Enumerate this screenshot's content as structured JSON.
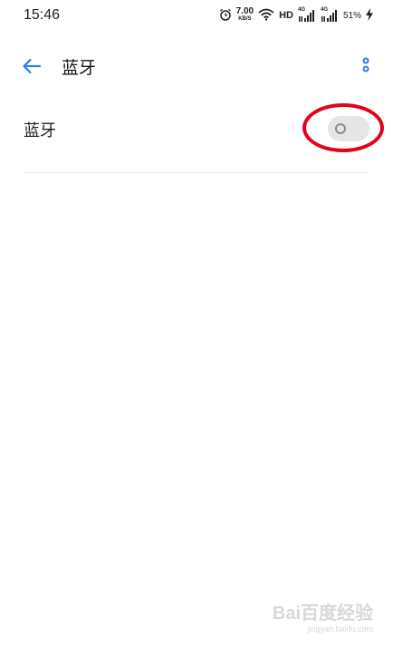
{
  "status_bar": {
    "time": "15:46",
    "net_speed_value": "7.00",
    "net_speed_unit": "KB/S",
    "hd_label": "HD",
    "signal1_tag": "4G",
    "signal2_tag": "4G",
    "battery": "51%",
    "icons": [
      "alarm-icon",
      "wifi-icon",
      "signal-icon",
      "signal-icon",
      "charging-icon"
    ]
  },
  "header": {
    "title": "蓝牙",
    "back_icon": "arrow-left-icon",
    "more_icon": "more-vertical-icon"
  },
  "settings": {
    "bluetooth": {
      "label": "蓝牙",
      "enabled": false
    }
  },
  "colors": {
    "accent": "#2f7fe8",
    "annotation": "#e3001b",
    "toggle_off_bg": "#e6e6e6"
  },
  "watermark": {
    "logo": "Bai百度经验",
    "url": "jingyan.baidu.com"
  }
}
